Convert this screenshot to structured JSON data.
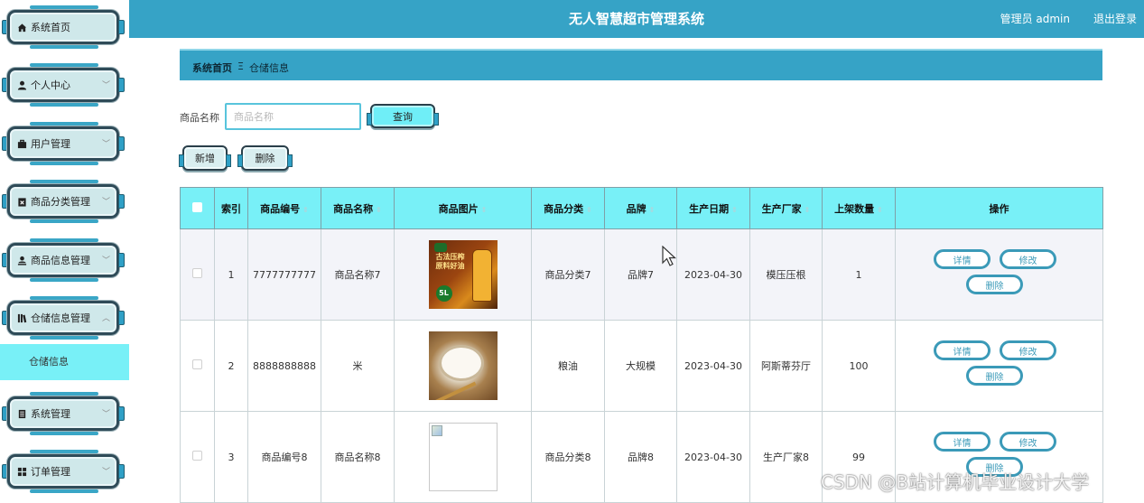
{
  "header": {
    "title": "无人智慧超市管理系统",
    "user_text": "管理员 admin",
    "logout": "退出登录"
  },
  "sidebar": {
    "items": [
      {
        "label": "系统首页",
        "icon": "home-icon",
        "expandable": false
      },
      {
        "label": "个人中心",
        "icon": "user-icon",
        "expandable": true
      },
      {
        "label": "用户管理",
        "icon": "briefcase-icon",
        "expandable": true
      },
      {
        "label": "商品分类管理",
        "icon": "clipboard-x-icon",
        "expandable": true
      },
      {
        "label": "商品信息管理",
        "icon": "user-upload-icon",
        "expandable": true
      },
      {
        "label": "仓储信息管理",
        "icon": "library-icon",
        "expandable": true,
        "expanded": true
      },
      {
        "label": "系统管理",
        "icon": "document-icon",
        "expandable": true
      },
      {
        "label": "订单管理",
        "icon": "grid-icon",
        "expandable": true
      }
    ],
    "sub_item": "仓储信息"
  },
  "breadcrumb": {
    "home": "系统首页",
    "separator": "Ξ",
    "current": "仓储信息"
  },
  "search": {
    "label": "商品名称",
    "placeholder": "商品名称",
    "value": "",
    "query_button": "查询"
  },
  "actions": {
    "add": "新增",
    "delete": "删除"
  },
  "table": {
    "columns": [
      "索引",
      "商品编号",
      "商品名称",
      "商品图片",
      "商品分类",
      "品牌",
      "生产日期",
      "生产厂家",
      "上架数量",
      "操作"
    ],
    "rows": [
      {
        "index": "1",
        "code": "7777777777",
        "name": "商品名称7",
        "image": "oil",
        "image_text": "古法压榨 原料好油",
        "badge": "5L",
        "category": "商品分类7",
        "brand": "品牌7",
        "date": "2023-04-30",
        "maker": "模压压根",
        "qty": "1"
      },
      {
        "index": "2",
        "code": "8888888888",
        "name": "米",
        "image": "rice",
        "category": "粮油",
        "brand": "大规模",
        "date": "2023-04-30",
        "maker": "阿斯蒂芬厅",
        "qty": "100"
      },
      {
        "index": "3",
        "code": "商品编号8",
        "name": "商品名称8",
        "image": "broken",
        "category": "商品分类8",
        "brand": "品牌8",
        "date": "2023-04-30",
        "maker": "生产厂家8",
        "qty": "99"
      }
    ],
    "row_actions": {
      "detail": "详情",
      "edit": "修改",
      "delete": "删除"
    }
  },
  "watermark": "CSDN @B站计算机毕业设计大学",
  "colors": {
    "header": "#36a3c6",
    "table_header": "#78f0f7",
    "accent_button": "#6feef7",
    "op_border": "#3b9ab8"
  }
}
